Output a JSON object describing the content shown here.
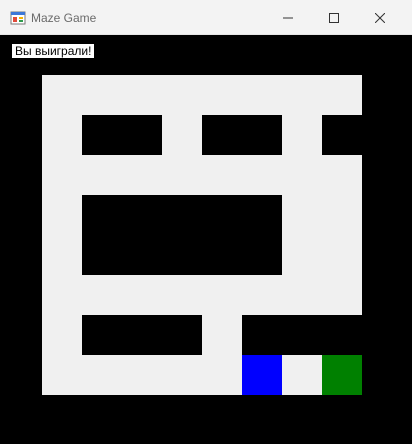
{
  "window": {
    "title": "Maze Game",
    "icon": "windows-forms-app-icon",
    "controls": [
      "minimize-icon",
      "maximize-icon",
      "close-icon"
    ]
  },
  "status": {
    "message": "Вы выиграли!"
  },
  "maze": {
    "rows": 8,
    "cols": 8,
    "legend": {
      "0": "path",
      "1": "wall",
      "2": "player",
      "3": "goal"
    },
    "colors": {
      "path": "#f0f0f0",
      "wall": "#000000",
      "player": "#0000ff",
      "goal": "#008000"
    },
    "grid": [
      [
        0,
        0,
        0,
        0,
        0,
        0,
        0,
        0
      ],
      [
        0,
        1,
        1,
        0,
        1,
        1,
        0,
        1
      ],
      [
        0,
        0,
        0,
        0,
        0,
        0,
        0,
        0
      ],
      [
        0,
        1,
        1,
        1,
        1,
        1,
        0,
        0
      ],
      [
        0,
        1,
        1,
        1,
        1,
        1,
        0,
        0
      ],
      [
        0,
        0,
        0,
        0,
        0,
        0,
        0,
        0
      ],
      [
        0,
        1,
        1,
        1,
        0,
        1,
        1,
        1
      ],
      [
        0,
        0,
        0,
        0,
        0,
        2,
        0,
        3
      ]
    ]
  }
}
